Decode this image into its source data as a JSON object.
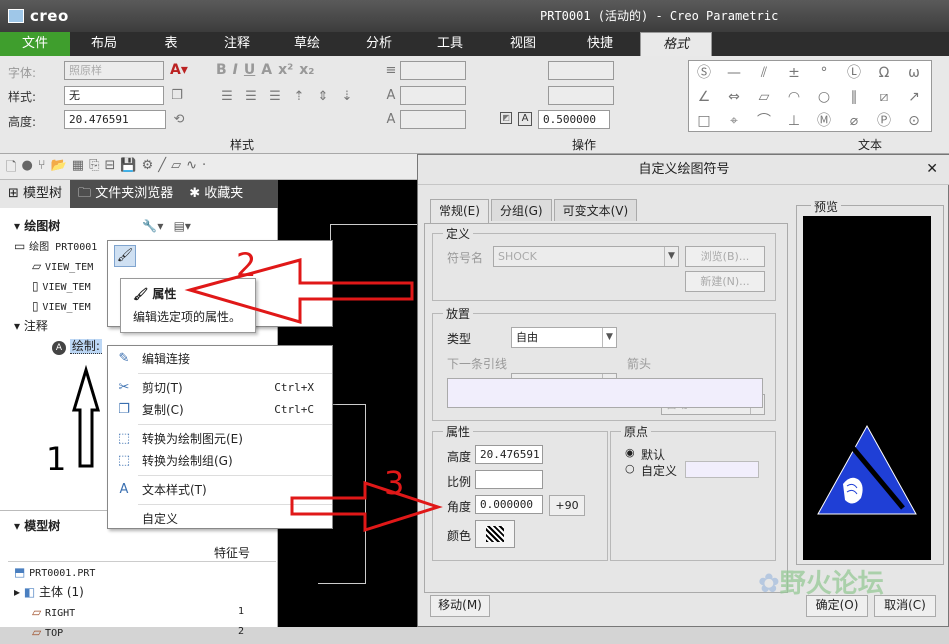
{
  "app": {
    "logo": "creo",
    "title": "PRT0001 (活动的) - Creo Parametric"
  },
  "ribbon_tabs": [
    "文件",
    "布局",
    "表",
    "注释",
    "草绘",
    "分析",
    "工具",
    "视图",
    "快捷",
    "格式"
  ],
  "ribbon": {
    "font_label": "字体:",
    "font_value": "照原样",
    "style_label": "样式:",
    "style_value": "无",
    "height_label": "高度:",
    "height_value": "20.476591",
    "style_group": "样式",
    "operation_group": "操作",
    "operation_value": "0.500000",
    "text_group": "文本",
    "format_buttons": [
      "B",
      "I",
      "U",
      "A",
      "x²",
      "x₂"
    ]
  },
  "left_panel": {
    "tabs": [
      "模型树",
      "文件夹浏览器",
      "收藏夹"
    ],
    "drawing_tree_title": "绘图树",
    "drawing_item": "绘图 PRT0001",
    "view_items": [
      "VIEW_TEM",
      "VIEW_TEM",
      "VIEW_TEM"
    ],
    "notes_label": "注释",
    "note_item": "绘制:",
    "model_tree_title": "模型树",
    "feature_col": "特征号",
    "model_items": [
      {
        "name": "PRT0001.PRT",
        "num": ""
      },
      {
        "name": "主体 (1)",
        "num": ""
      },
      {
        "name": "RIGHT",
        "num": "1"
      },
      {
        "name": "TOP",
        "num": "2"
      }
    ]
  },
  "tooltip": {
    "title": "属性",
    "desc": "编辑选定项的属性。"
  },
  "context_menu": [
    {
      "label": "编辑连接",
      "key": ""
    },
    {
      "label": "剪切(T)",
      "key": "Ctrl+X"
    },
    {
      "label": "复制(C)",
      "key": "Ctrl+C"
    },
    {
      "label": "转换为绘制图元(E)",
      "key": ""
    },
    {
      "label": "转换为绘制组(G)",
      "key": ""
    },
    {
      "label": "文本样式(T)",
      "key": ""
    },
    {
      "label": "自定义",
      "key": ""
    }
  ],
  "annotations": {
    "n1": "1",
    "n2": "2",
    "n3": "3"
  },
  "dialog": {
    "title": "自定义绘图符号",
    "tabs": [
      "常规(E)",
      "分组(G)",
      "可变文本(V)"
    ],
    "definition_label": "定义",
    "symbol_name_label": "符号名",
    "symbol_name_value": "SHOCK",
    "browse_btn": "浏览(B)...",
    "new_btn": "新建(N)...",
    "placement_label": "放置",
    "type_label": "类型",
    "type_value": "自由",
    "next_leader_label": "下一条引线",
    "arrow_label": "箭头",
    "arrow_value": "自动",
    "properties_label": "属性",
    "height_label": "高度",
    "height_value": "20.476591",
    "scale_label": "比例",
    "scale_value": "",
    "angle_label": "角度",
    "angle_value": "0.000000",
    "plus90": "+90",
    "color_label": "颜色",
    "origin_label": "原点",
    "origin_default": "默认",
    "origin_custom": "自定义",
    "preview_label": "预览",
    "move_btn": "移动(M)",
    "ok_btn": "确定(O)",
    "cancel_btn": "取消(C)",
    "watermark": "野火论坛"
  },
  "colors": {
    "file_tab": "#3f9e2d",
    "arrow": "#e01818",
    "preview_bg": "#000000",
    "symbol_blue": "#1f3fd6"
  }
}
